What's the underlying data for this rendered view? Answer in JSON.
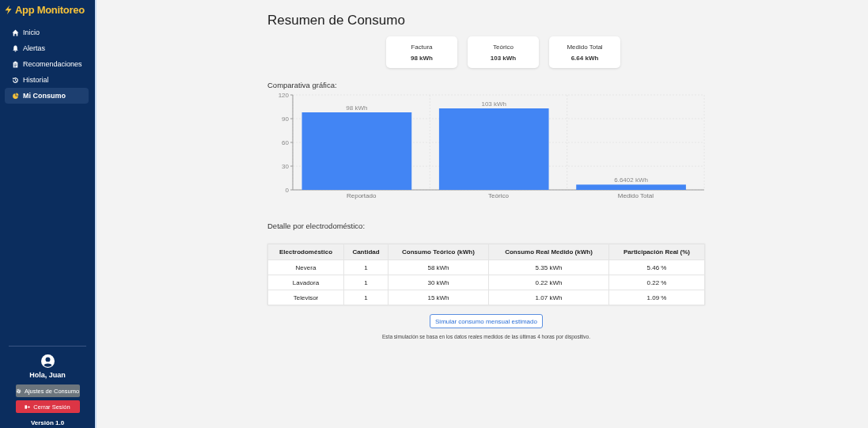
{
  "sidebar": {
    "app_title": "App Monitoreo",
    "items": [
      {
        "label": "Inicio",
        "selected": false
      },
      {
        "label": "Alertas",
        "selected": false
      },
      {
        "label": "Recomendaciones",
        "selected": false
      },
      {
        "label": "Historial",
        "selected": false
      },
      {
        "label": "Mi Consumo",
        "selected": true
      }
    ],
    "greeting": "Hola, Juan",
    "settings_button": "Ajustes de Consumo",
    "logout_button": "Cerrar Sesión",
    "version": "Versión 1.0"
  },
  "main": {
    "title": "Resumen de Consumo",
    "summary_cards": [
      {
        "label": "Factura",
        "value": "98 kWh"
      },
      {
        "label": "Teórico",
        "value": "103 kWh"
      },
      {
        "label": "Medido Total",
        "value": "6.64 kWh"
      }
    ],
    "chart_heading": "Comparativa gráfica:",
    "chart_data": {
      "type": "bar",
      "categories": [
        "Reportado",
        "Teórico",
        "Medido Total"
      ],
      "values": [
        98,
        103,
        6.6402
      ],
      "ylim": [
        0,
        120
      ],
      "grid": true,
      "yticks": [
        0,
        30,
        60,
        90,
        120
      ],
      "value_labels": [
        "98 kWh",
        "103 kWh",
        "6.6402 kWh"
      ]
    },
    "table_heading": "Detalle por electrodoméstico:",
    "table": {
      "columns": [
        "Electrodoméstico",
        "Cantidad",
        "Consumo Teórico (kWh)",
        "Consumo Real Medido (kWh)",
        "Participación Real (%)"
      ],
      "rows": [
        [
          "Nevera",
          "1",
          "58 kWh",
          "5.35 kWh",
          "5.46 %"
        ],
        [
          "Lavadora",
          "1",
          "30 kWh",
          "0.22 kWh",
          "0.22 %"
        ],
        [
          "Televisor",
          "1",
          "15 kWh",
          "1.07 kWh",
          "1.09 %"
        ]
      ]
    },
    "simulate_button": "Simular consumo mensual estimado",
    "note": "Esta simulación se basa en los datos reales medidos de las últimas 4 horas por dispositivo."
  }
}
